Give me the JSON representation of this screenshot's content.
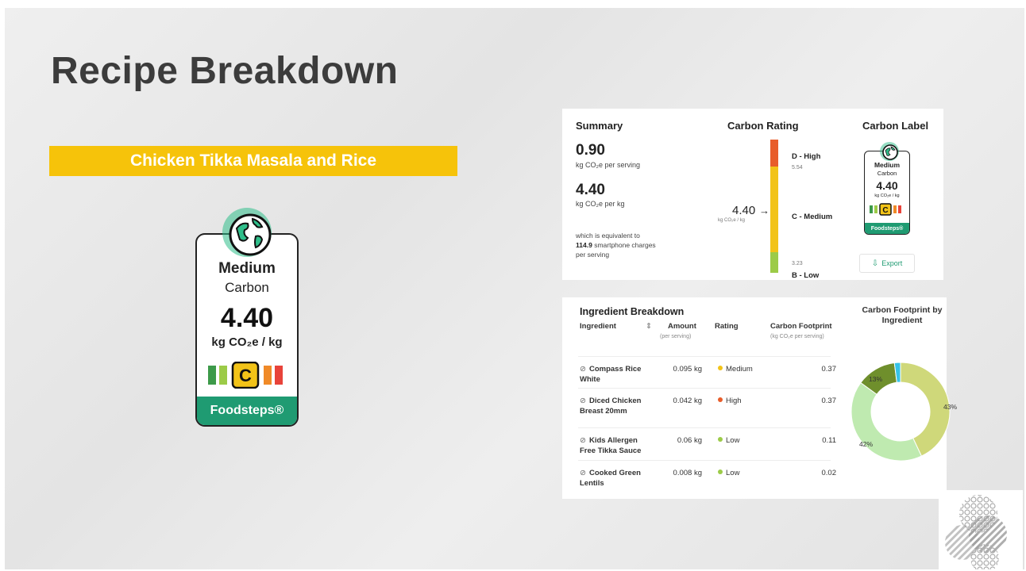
{
  "slide": {
    "title": "Recipe Breakdown",
    "recipe_name": "Chicken Tikka Masala and Rice"
  },
  "big_label": {
    "rating_word": "Medium",
    "rating_suffix": "Carbon",
    "value": "4.40",
    "unit": "kg CO₂e / kg",
    "grade_letter": "C",
    "brand": "Foodsteps®"
  },
  "summary": {
    "heading": "Summary",
    "per_serving_value": "0.90",
    "per_serving_unit": "kg CO₂e per serving",
    "per_kg_value": "4.40",
    "per_kg_unit": "kg CO₂e per kg",
    "equiv_prefix": "which is equivalent to",
    "equiv_value": "114.9",
    "equiv_suffix": "smartphone charges",
    "equiv_suffix2": "per serving"
  },
  "carbon_rating": {
    "heading": "Carbon Rating",
    "top_label": "D - High",
    "top_tick": "5.54",
    "mid_label": "C - Medium",
    "bottom_tick": "3.23",
    "bottom_label": "B - Low",
    "pointer_value": "4.40",
    "pointer_unit": "kg CO₂e / kg",
    "colors": {
      "high": "#e85d2a",
      "medium": "#f2c318",
      "low": "#9ccb48"
    }
  },
  "carbon_label": {
    "heading": "Carbon Label",
    "rating_word": "Medium",
    "rating_suffix": "Carbon",
    "value": "4.40",
    "unit": "kg CO₂e / kg",
    "brand": "Foodsteps®",
    "export_label": "Export"
  },
  "ingredients": {
    "title": "Ingredient Breakdown",
    "columns": {
      "ingredient": "Ingredient",
      "amount": "Amount",
      "amount_sub": "(per serving)",
      "rating": "Rating",
      "footprint": "Carbon Footprint",
      "footprint_sub": "(kg CO₂e per serving)"
    },
    "rows": [
      {
        "name": "Compass Rice White",
        "amount": "0.095 kg",
        "rating": "Medium",
        "color": "#f2c318",
        "footprint": "0.37"
      },
      {
        "name": "Diced Chicken Breast 20mm",
        "amount": "0.042 kg",
        "rating": "High",
        "color": "#e85d2a",
        "footprint": "0.37"
      },
      {
        "name": "Kids Allergen Free Tikka Sauce",
        "amount": "0.06 kg",
        "rating": "Low",
        "color": "#9ccb48",
        "footprint": "0.11"
      },
      {
        "name": "Cooked Green Lentils",
        "amount": "0.008 kg",
        "rating": "Low",
        "color": "#9ccb48",
        "footprint": "0.02"
      }
    ]
  },
  "chart_data": {
    "type": "pie",
    "title": "Carbon Footprint by Ingredient",
    "slices": [
      {
        "label": "43%",
        "value": 43,
        "color": "#cfd87a"
      },
      {
        "label": "42%",
        "value": 42,
        "color": "#bfeab0"
      },
      {
        "label": "13%",
        "value": 13,
        "color": "#6f8f2c"
      },
      {
        "label": "",
        "value": 2,
        "color": "#36c3e8"
      }
    ]
  }
}
